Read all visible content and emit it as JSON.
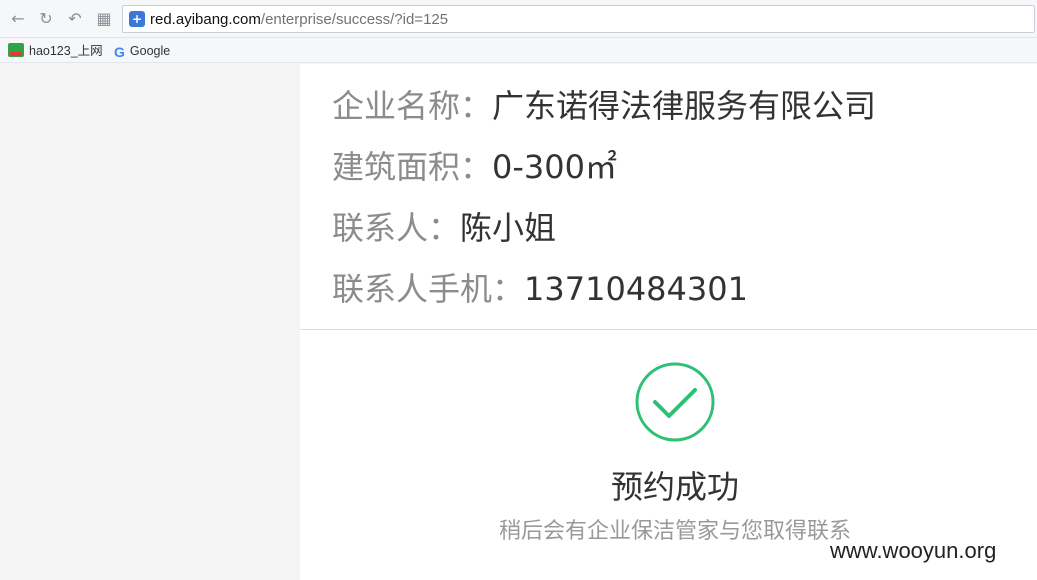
{
  "browser": {
    "url_host": "red.ayibang.com",
    "url_path": "/enterprise/success/?id=125",
    "bookmarks": [
      {
        "label": "hao123_上网"
      },
      {
        "label": "Google"
      }
    ]
  },
  "info": {
    "company": {
      "label": "企业名称：",
      "value": "广东诺得法律服务有限公司"
    },
    "area": {
      "label": "建筑面积：",
      "value": "0-300㎡"
    },
    "contact": {
      "label": "联系人：",
      "value": "陈小姐"
    },
    "phone": {
      "label": "联系人手机：",
      "value": "13710484301"
    }
  },
  "success": {
    "title": "预约成功",
    "subtitle": "稍后会有企业保洁管家与您取得联系",
    "color": "#2ec074"
  },
  "watermark": "www.wooyun.org"
}
